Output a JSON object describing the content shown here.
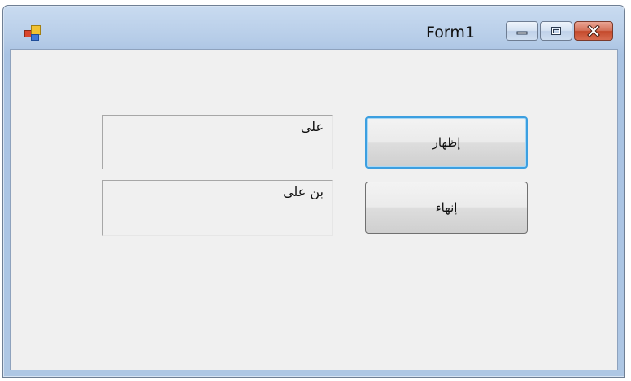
{
  "window": {
    "title": "Form1"
  },
  "caption_buttons": {
    "minimize_icon": "minimize-icon",
    "maximize_icon": "maximize-icon",
    "close_icon": "close-icon"
  },
  "form": {
    "textbox1": {
      "value": "على"
    },
    "textbox2": {
      "value": "بن على"
    },
    "show_button": {
      "label": "إظهار"
    },
    "exit_button": {
      "label": "إنهاء"
    }
  },
  "colors": {
    "client_background": "#f0f0f0",
    "focus_border": "#3c9fe0",
    "close_button": "#c44a2c"
  }
}
